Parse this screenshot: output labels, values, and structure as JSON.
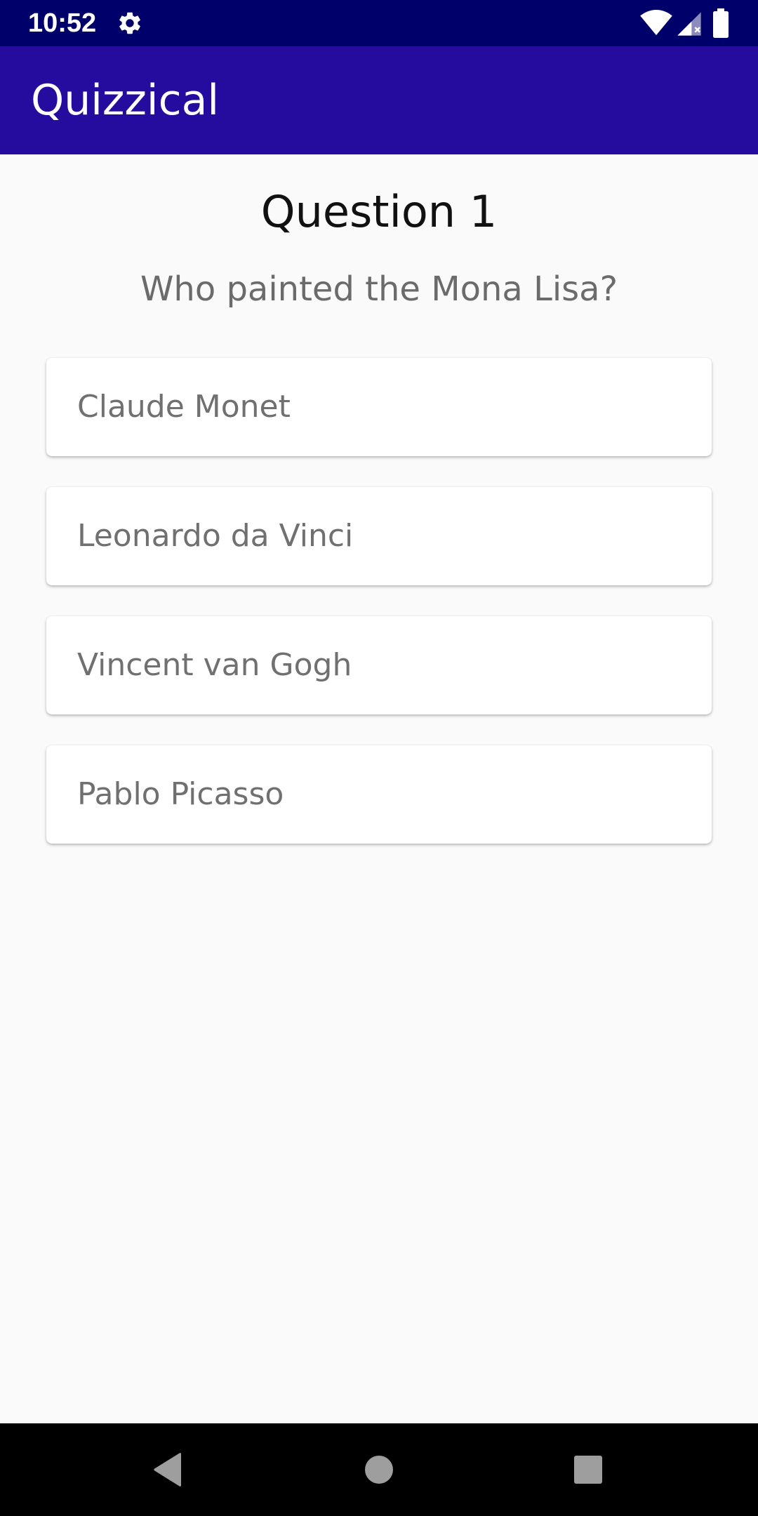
{
  "status_bar": {
    "time": "10:52",
    "icons": [
      "gear-icon",
      "wifi-icon",
      "signal-icon",
      "battery-icon"
    ]
  },
  "app_bar": {
    "title": "Quizzical",
    "color": "#260b9f"
  },
  "quiz": {
    "question_number": "Question 1",
    "question_text": "Who painted the Mona Lisa?",
    "answers": [
      "Claude Monet",
      "Leonardo da Vinci",
      "Vincent van Gogh",
      "Pablo Picasso"
    ]
  },
  "nav_bar": {
    "icons": [
      "back-icon",
      "home-icon",
      "recents-icon"
    ]
  },
  "colors": {
    "status_bar": "#00006b",
    "app_bar": "#260b9f",
    "background": "#fafafa"
  }
}
